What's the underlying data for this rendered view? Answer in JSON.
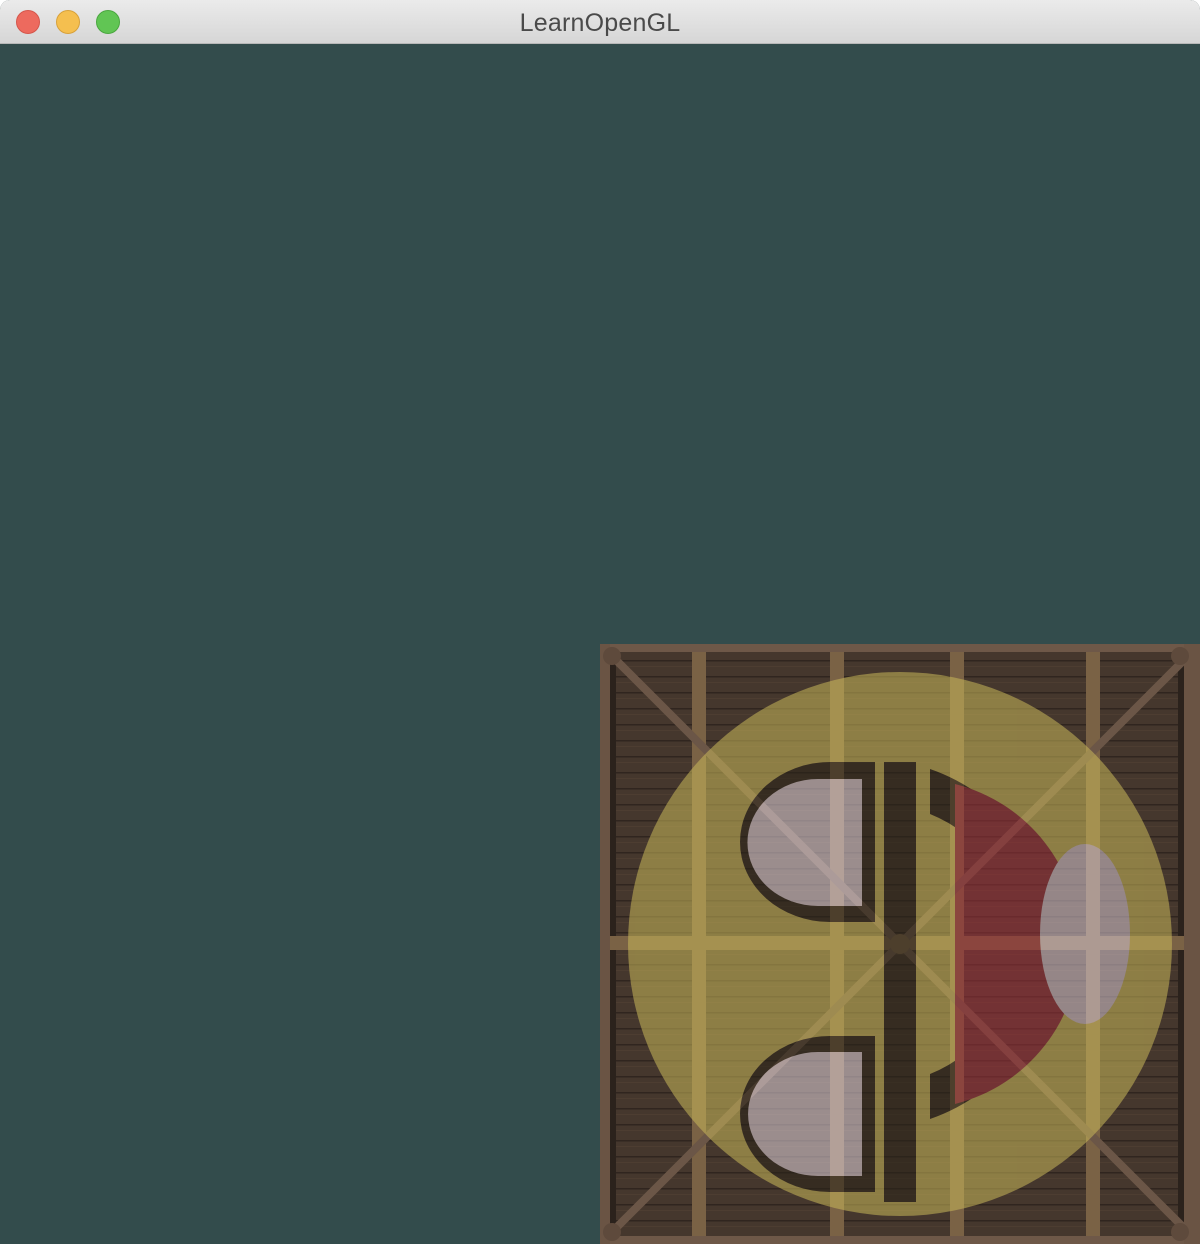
{
  "window": {
    "title": "LearnOpenGL"
  },
  "viewport": {
    "clear_color": "#334c4c",
    "quad": {
      "texture_1": "wooden-container",
      "texture_2": "awesomeface",
      "mix": 0.2
    }
  },
  "icons": {
    "close": "close-icon",
    "minimize": "minimize-icon",
    "zoom": "zoom-icon"
  }
}
